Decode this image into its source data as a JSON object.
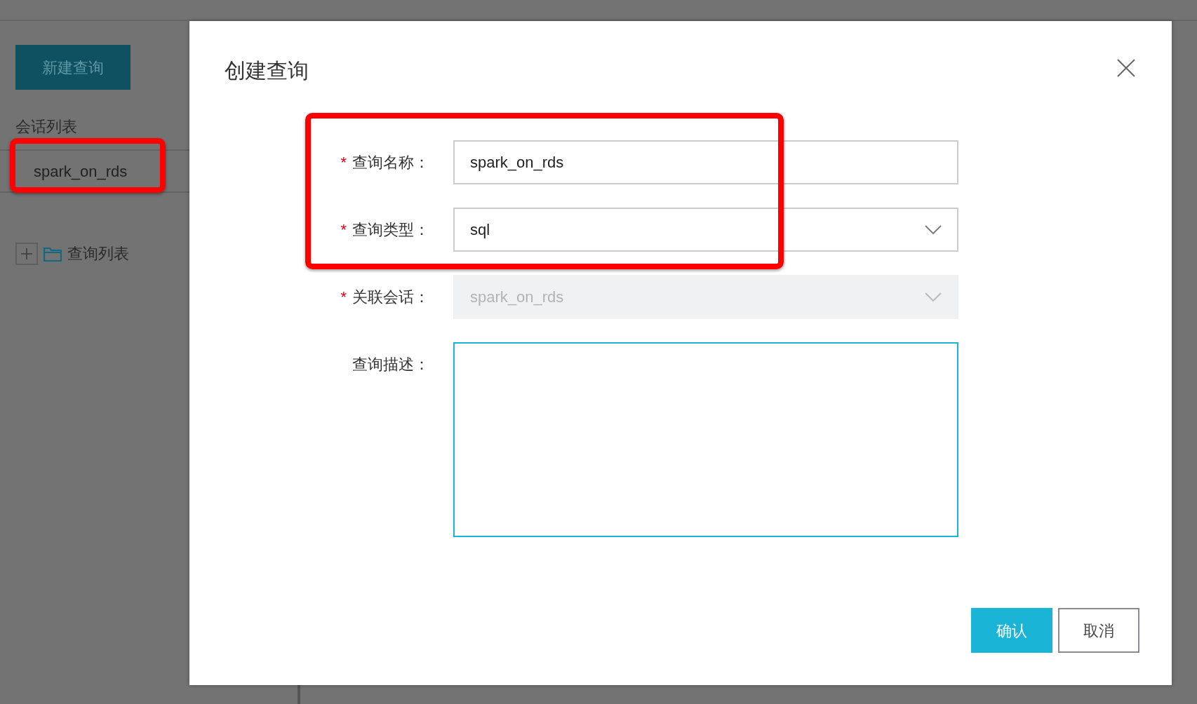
{
  "sidebar": {
    "new_query_button": "新建查询",
    "session_list_title": "会话列表",
    "sessions": [
      {
        "name": "spark_on_rds",
        "highlighted": true
      }
    ],
    "tree": [
      {
        "label": "查询列表",
        "expanded": false
      }
    ]
  },
  "dialog": {
    "title": "创建查询",
    "fields": [
      {
        "kind": "text",
        "required_mark": "*",
        "label": "查询名称：",
        "value": "spark_on_rds",
        "highlighted": true
      },
      {
        "kind": "select",
        "required_mark": "*",
        "label": "查询类型：",
        "value": "sql",
        "highlighted": true
      },
      {
        "kind": "select",
        "required_mark": "*",
        "label": "关联会话：",
        "value": "spark_on_rds",
        "disabled": true,
        "highlighted": false
      },
      {
        "kind": "textarea",
        "label": "查询描述：",
        "focused": true,
        "highlighted": false
      }
    ],
    "buttons": [
      {
        "kind": "primary",
        "label": "确认"
      },
      {
        "kind": "secondary",
        "label": "取消"
      }
    ]
  }
}
